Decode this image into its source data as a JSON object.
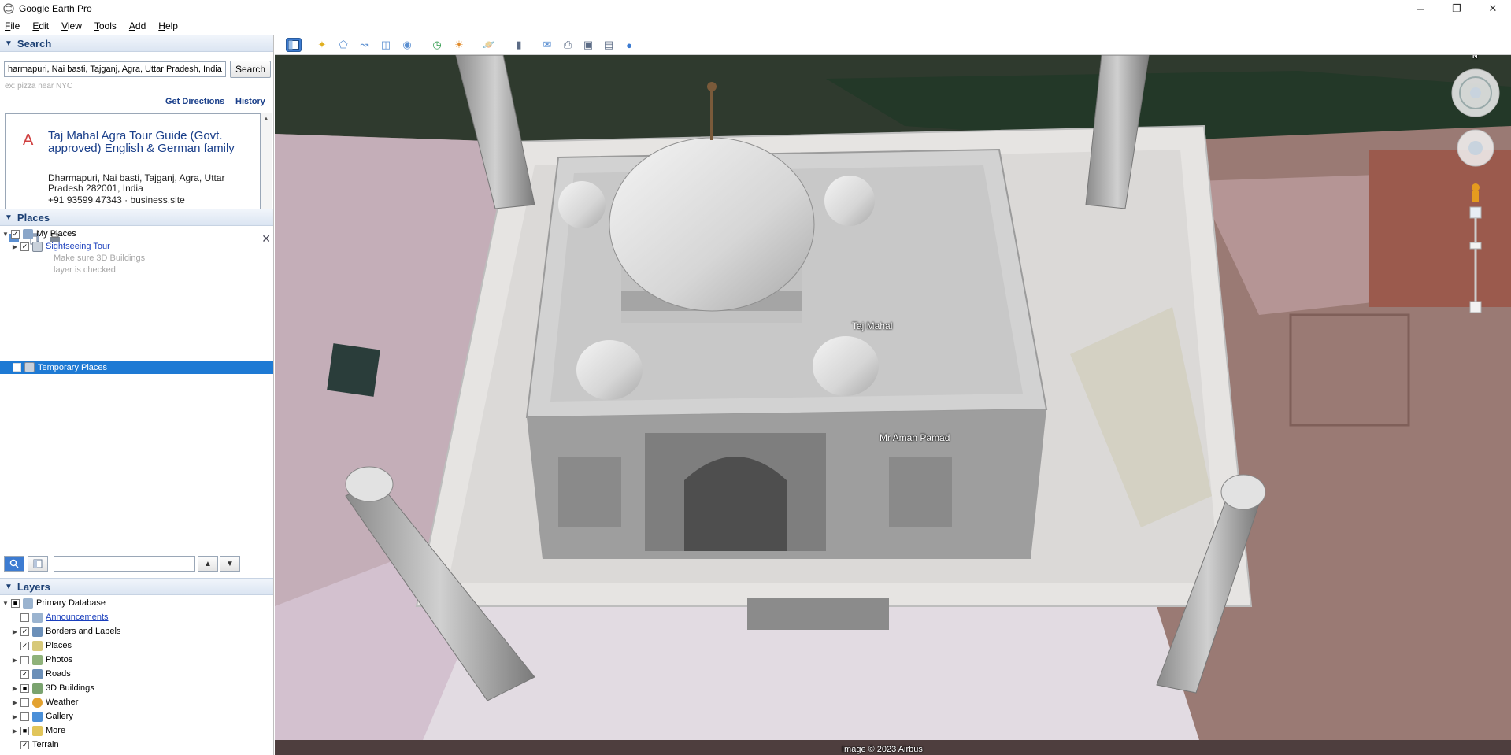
{
  "window": {
    "title": "Google Earth Pro",
    "controls": {
      "minimize": "─",
      "restore": "❐",
      "close": "✕"
    }
  },
  "menu": [
    {
      "label": "File",
      "key": "F",
      "rest": "ile"
    },
    {
      "label": "Edit",
      "key": "E",
      "rest": "dit"
    },
    {
      "label": "View",
      "key": "V",
      "rest": "iew"
    },
    {
      "label": "Tools",
      "key": "T",
      "rest": "ools"
    },
    {
      "label": "Add",
      "key": "A",
      "rest": "dd"
    },
    {
      "label": "Help",
      "key": "H",
      "rest": "elp"
    }
  ],
  "search": {
    "header": "Search",
    "query": "harmapuri, Nai basti, Tajganj, Agra, Uttar Pradesh, India",
    "button": "Search",
    "hint": "ex: pizza near NYC",
    "get_directions": "Get Directions",
    "history": "History",
    "result": {
      "marker": "A",
      "title": "Taj Mahal Agra Tour Guide (Govt. approved) English & German family",
      "address": "Dharmapuri, Nai basti, Tajganj, Agra, Uttar Pradesh 282001, India",
      "phone": "+91 93599 47343 · business.site"
    },
    "close": "✕"
  },
  "places": {
    "header": "Places",
    "items": [
      {
        "label": "My Places"
      },
      {
        "label": "Sightseeing Tour"
      },
      {
        "label": "Make sure 3D Buildings"
      },
      {
        "label": "layer is checked"
      },
      {
        "label": "Temporary Places"
      }
    ],
    "up": "▲",
    "down": "▼"
  },
  "layers": {
    "header": "Layers",
    "items": [
      {
        "label": "Primary Database"
      },
      {
        "label": "Announcements"
      },
      {
        "label": "Borders and Labels"
      },
      {
        "label": "Places"
      },
      {
        "label": "Photos"
      },
      {
        "label": "Roads"
      },
      {
        "label": "3D Buildings"
      },
      {
        "label": "Weather"
      },
      {
        "label": "Gallery"
      },
      {
        "label": "More"
      },
      {
        "label": "Terrain"
      }
    ]
  },
  "map": {
    "labels": {
      "taj_mahal": "Taj Mahal",
      "mr_aman_pamad": "Mr Aman Pamad"
    },
    "attribution": "Image © 2023 Airbus",
    "compass_n": "N"
  },
  "colors": {
    "panel_header": "#1b3f73",
    "selection": "#1e7ad4",
    "link": "#1a3fbd"
  }
}
